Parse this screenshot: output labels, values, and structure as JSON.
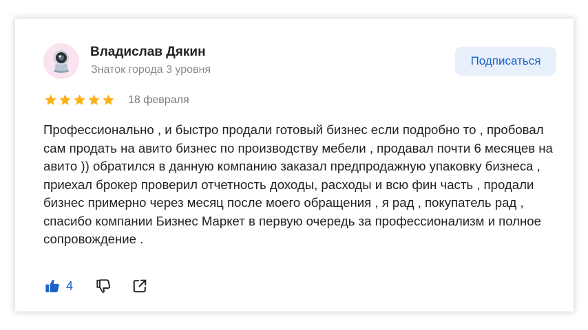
{
  "review": {
    "author": {
      "name": "Владислав Дякин",
      "status": "Знаток города 3 уровня",
      "avatar_icon": "robot-avatar-icon"
    },
    "subscribe_label": "Подписаться",
    "rating": 5,
    "rating_max": 5,
    "date": "18 февраля",
    "text": "Профессионально , и быстро продали готовый бизнес если подробно то , пробовал сам продать на авито бизнес по производству мебели , продавал почти 6 месяцев на авито )) обратился в данную компанию заказал предпродажную упаковку бизнеса , приехал брокер проверил отчетность доходы, расходы и всю фин часть , продали бизнес примерно через месяц после моего обращения , я рад , покупатель рад , спасибо компании Бизнес Маркет в первую очередь за профессионализм и полное сопровождение .",
    "likes": "4",
    "icons": {
      "like": "thumbs-up-icon",
      "dislike": "thumbs-down-icon",
      "share": "share-icon"
    }
  },
  "colors": {
    "accent": "#1a63c8",
    "star": "#fcb216",
    "subscribe_bg": "#e7f0fb",
    "avatar_bg": "#f9e3ee"
  }
}
